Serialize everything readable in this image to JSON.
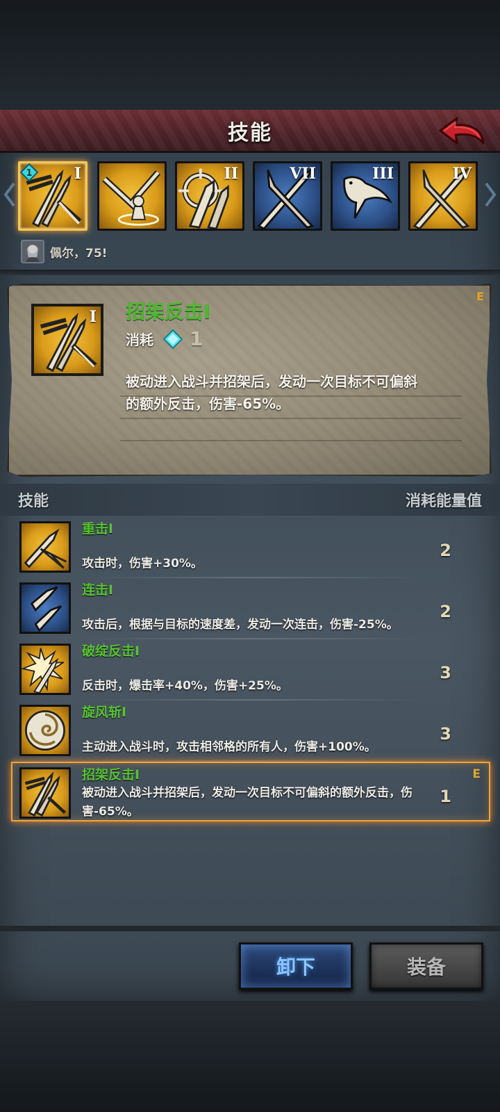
{
  "header": {
    "title": "技能"
  },
  "skill_slots": [
    {
      "icon": "parry-swords-icon",
      "rank": "I",
      "color": "gold",
      "selected": true,
      "cost_badge": "1"
    },
    {
      "icon": "sword-summon-icon",
      "rank": "",
      "color": "gold",
      "selected": false
    },
    {
      "icon": "crosshair-arrow-icon",
      "rank": "II",
      "color": "gold",
      "selected": false
    },
    {
      "icon": "crossed-blades-icon",
      "rank": "VII",
      "color": "blue",
      "selected": false
    },
    {
      "icon": "swift-hawk-icon",
      "rank": "III",
      "color": "blue",
      "selected": false
    },
    {
      "icon": "crossed-blades-icon",
      "rank": "IV",
      "color": "gold",
      "selected": false
    }
  ],
  "character": {
    "text": "佩尔，75!"
  },
  "detail": {
    "rank_letter": "E",
    "icon_rank": "I",
    "title": "招架反击I",
    "cost_label": "消耗",
    "cost_value": "1",
    "description": "被动进入战斗并招架后，发动一次目标不可偏斜的额外反击，伤害-65%。"
  },
  "list_header": {
    "left": "技能",
    "right": "消耗能量值"
  },
  "skills": [
    {
      "name": "重击I",
      "desc": "攻击时，伤害+30%。",
      "cost": "2",
      "color": "gold",
      "icon": "heavy-strike-icon"
    },
    {
      "name": "连击I",
      "desc": "攻击后，根据与目标的速度差，发动一次连击，伤害-25%。",
      "cost": "2",
      "color": "blue",
      "icon": "combo-strike-icon"
    },
    {
      "name": "破绽反击I",
      "desc": "反击时，爆击率+40%，伤害+25%。",
      "cost": "3",
      "color": "gold",
      "icon": "burst-counter-icon"
    },
    {
      "name": "旋风斩I",
      "desc": "主动进入战斗时，攻击相邻格的所有人，伤害+100%。",
      "cost": "3",
      "color": "gold",
      "icon": "whirlwind-icon"
    },
    {
      "name": "招架反击I",
      "desc": "被动进入战斗并招架后，发动一次目标不可偏斜的额外反击，伤害-65%。",
      "cost": "1",
      "color": "gold",
      "icon": "parry-swords-icon",
      "rank_letter": "E"
    }
  ],
  "buttons": {
    "unequip": "卸下",
    "equip": "装备"
  },
  "colors": {
    "skill_name": "#58c234",
    "accent_gold": "#e2a629",
    "highlight": "#f2a33a"
  }
}
